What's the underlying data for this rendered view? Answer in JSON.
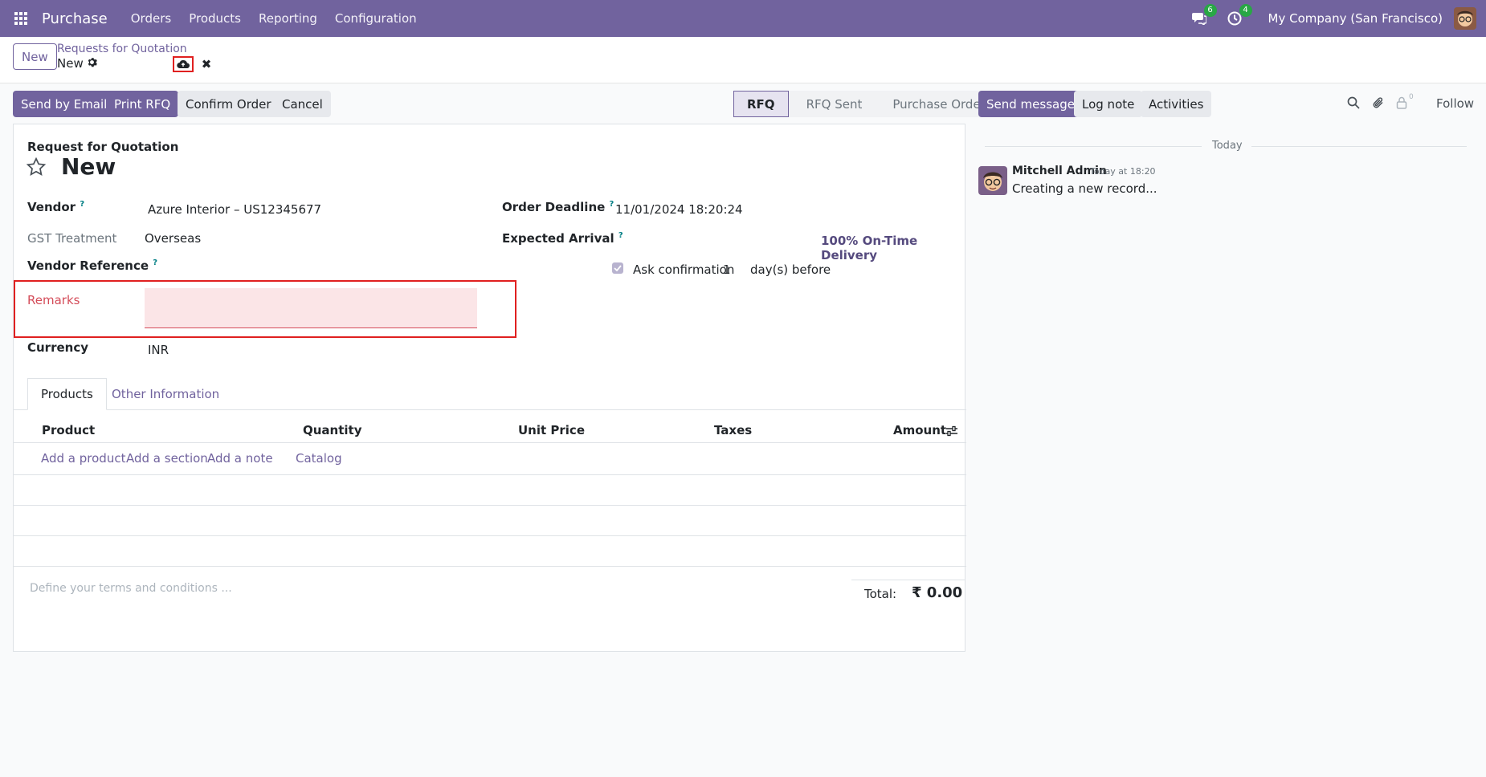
{
  "navbar": {
    "app_name": "Purchase",
    "menu": [
      "Orders",
      "Products",
      "Reporting",
      "Configuration"
    ],
    "messages_count": "6",
    "activities_count": "4",
    "company": "My Company (San Francisco)"
  },
  "control_panel": {
    "new_label": "New",
    "breadcrumb_parent": "Requests for Quotation",
    "breadcrumb_current": "New"
  },
  "actions": {
    "send_by_email": "Send by Email",
    "print_rfq": "Print RFQ",
    "confirm_order": "Confirm Order",
    "cancel": "Cancel"
  },
  "statusbar": {
    "steps": [
      "RFQ",
      "RFQ Sent",
      "Purchase Order"
    ],
    "active": "RFQ"
  },
  "form": {
    "subtitle": "Request for Quotation",
    "name": "New",
    "vendor_label": "Vendor",
    "vendor_value": "Azure Interior – US12345677",
    "gst_label": "GST Treatment",
    "gst_value": "Overseas",
    "vendor_ref_label": "Vendor Reference",
    "remarks_label": "Remarks",
    "remarks_value": "",
    "currency_label": "Currency",
    "currency_value": "INR",
    "order_deadline_label": "Order Deadline",
    "order_deadline_value": "11/01/2024 18:20:24",
    "expected_arrival_label": "Expected Arrival",
    "on_time_delivery": "100% On-Time Delivery",
    "ask_confirmation_label": "Ask confirmation",
    "ask_confirmation_days": "1",
    "days_before": "day(s) before",
    "tip_mark": "?"
  },
  "tabs": [
    "Products",
    "Other Information"
  ],
  "table": {
    "headers": [
      "Product",
      "Quantity",
      "Unit Price",
      "Taxes",
      "Amount"
    ],
    "add_links": [
      "Add a product",
      "Add a section",
      "Add a note",
      "Catalog"
    ]
  },
  "footer": {
    "terms_placeholder": "Define your terms and conditions ...",
    "total_label": "Total:",
    "total_value": "₹ 0.00"
  },
  "chatter": {
    "send_message": "Send message",
    "log_note": "Log note",
    "activities": "Activities",
    "followers_count": "0",
    "follow": "Follow",
    "date_separator": "Today",
    "message": {
      "author": "Mitchell Admin",
      "time": "Today at 18:20",
      "body": "Creating a new record..."
    }
  },
  "colors": {
    "brand": "#71639e",
    "badge": "#28a745",
    "invalid": "#d44c59",
    "highlight_box": "#e02020"
  }
}
